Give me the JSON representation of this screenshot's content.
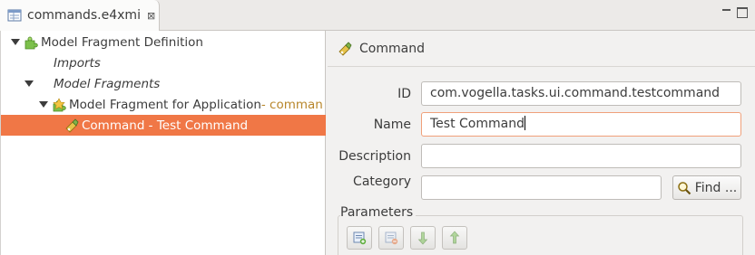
{
  "editor": {
    "tab_title": "commands.e4xmi",
    "tab_close": "⊠",
    "window_controls": [
      "minimize",
      "maximize"
    ]
  },
  "tree": {
    "items": [
      {
        "label": "Model Fragment Definition",
        "suffix": "",
        "italic": false,
        "icon": "puzzle-icon",
        "expanded": true,
        "selected": false
      },
      {
        "label": "Imports",
        "suffix": "",
        "italic": true,
        "icon": "",
        "expanded": false,
        "selected": false
      },
      {
        "label": "Model Fragments",
        "suffix": "",
        "italic": true,
        "icon": "",
        "expanded": true,
        "selected": false
      },
      {
        "label": "Model Fragment for Application",
        "suffix": " - comman",
        "italic": false,
        "icon": "fragment-icon",
        "expanded": true,
        "selected": false
      },
      {
        "label": "Command - Test Command",
        "suffix": "",
        "italic": false,
        "icon": "command-icon",
        "expanded": false,
        "selected": true
      }
    ]
  },
  "details": {
    "title": "Command",
    "title_icon": "command-icon",
    "fields": {
      "id": {
        "label": "ID",
        "value": "com.vogella.tasks.ui.command.testcommand"
      },
      "name": {
        "label": "Name",
        "value": "Test Command"
      },
      "description": {
        "label": "Description",
        "value": ""
      },
      "category": {
        "label": "Category",
        "value": ""
      }
    },
    "find_button": "Find ...",
    "parameters_label": "Parameters",
    "parameter_toolbar": [
      "add-parameter-icon",
      "remove-parameter-icon",
      "move-down-icon",
      "move-up-icon"
    ]
  },
  "colors": {
    "selection": "#f07746",
    "focus_border": "#f0a07a",
    "suffix_text": "#b8862b"
  }
}
